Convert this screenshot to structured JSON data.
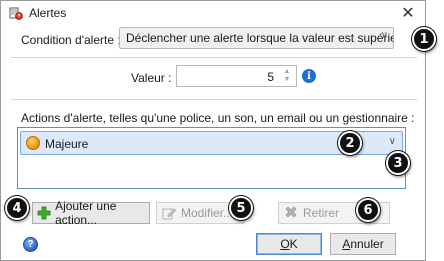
{
  "window": {
    "title": "Alertes",
    "close_glyph": "✕"
  },
  "condition": {
    "label": "Condition d'alerte :",
    "selected": "Déclencher une alerte lorsque la valeur est supérieure à"
  },
  "value": {
    "label": "Valeur :",
    "value": "5"
  },
  "actions": {
    "label": "Actions d'alerte, telles qu'une police, un son, un email ou un gestionnaire :",
    "items": [
      {
        "label": "Majeure",
        "icon": "orange-circle-icon",
        "color": "#f5a017"
      }
    ]
  },
  "buttons": {
    "add": "Ajouter une action...",
    "modify": "Modifier...",
    "remove": "Retirer",
    "ok": "OK",
    "ok_accel": "O",
    "ok_rest": "K",
    "cancel": "Annuler",
    "cancel_accel": "A",
    "cancel_rest": "nnuler"
  },
  "callouts": [
    "1",
    "2",
    "3",
    "4",
    "5",
    "6"
  ],
  "colors": {
    "accent": "#1e6fd9",
    "selection": "#dbe9fb",
    "badge": "#111111"
  }
}
